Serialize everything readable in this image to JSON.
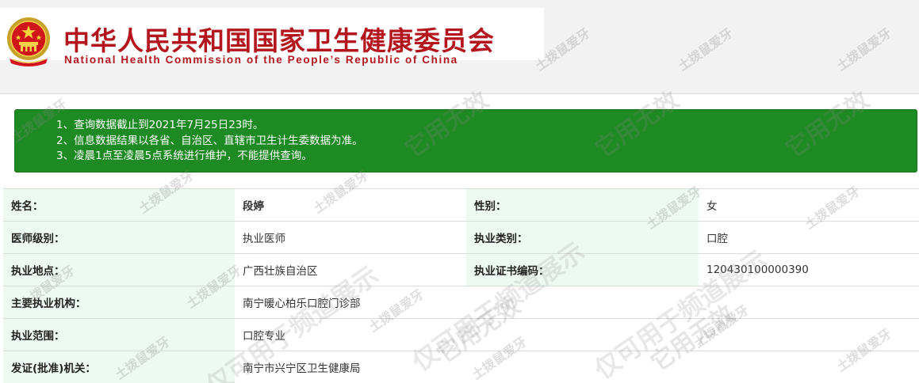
{
  "header": {
    "title_cn": "中华人民共和国国家卫生健康委员会",
    "title_en": "National Health Commission of the People’s Republic of China",
    "brand_color": "#b3171d"
  },
  "notice": {
    "lines": [
      "1、查询数据截止到2021年7月25日23时。",
      "2、信息数据结果以各省、自治区、直辖市卫生计生委数据为准。",
      "3、凌晨1点至凌晨5点系统进行维护，不能提供查询。"
    ],
    "background_color": "#1e8a23"
  },
  "record": {
    "name_label": "姓名：",
    "name_value": "段婷",
    "gender_label": "性别：",
    "gender_value": "女",
    "level_label": "医师级别：",
    "level_value": "执业医师",
    "category_label": "执业类别：",
    "category_value": "口腔",
    "location_label": "执业地点：",
    "location_value": "广西壮族自治区",
    "cert_label": "执业证书编码：",
    "cert_value": "120430100000390",
    "institution_label": "主要执业机构：",
    "institution_value": "南宁暖心柏乐口腔门诊部",
    "scope_label": "执业范围：",
    "scope_value": "口腔专业",
    "issuer_label": "发证(批准)机关：",
    "issuer_value": "南宁市兴宁区卫生健康局"
  },
  "watermark": {
    "small_text": "土拨鼠爱牙",
    "large_text": "仅可用于频道展示",
    "invalid_text": "它用无效"
  }
}
